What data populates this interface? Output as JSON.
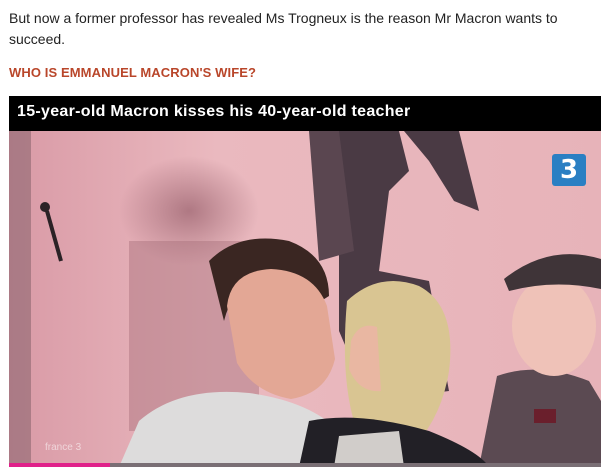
{
  "article": {
    "intro": "But now a former professor has revealed Ms Trogneux is the reason Mr Macron wants to succeed.",
    "subhead": "WHO IS EMMANUEL MACRON'S WIFE?"
  },
  "video": {
    "title": "15-year-old Macron kisses his 40-year-old teacher",
    "channel_logo": "3",
    "watermark": "france 3",
    "progress_fraction": 0.17,
    "colors": {
      "title_bar": "#000000",
      "progress": "#e0218a",
      "logo": "#2a7fc3"
    }
  }
}
